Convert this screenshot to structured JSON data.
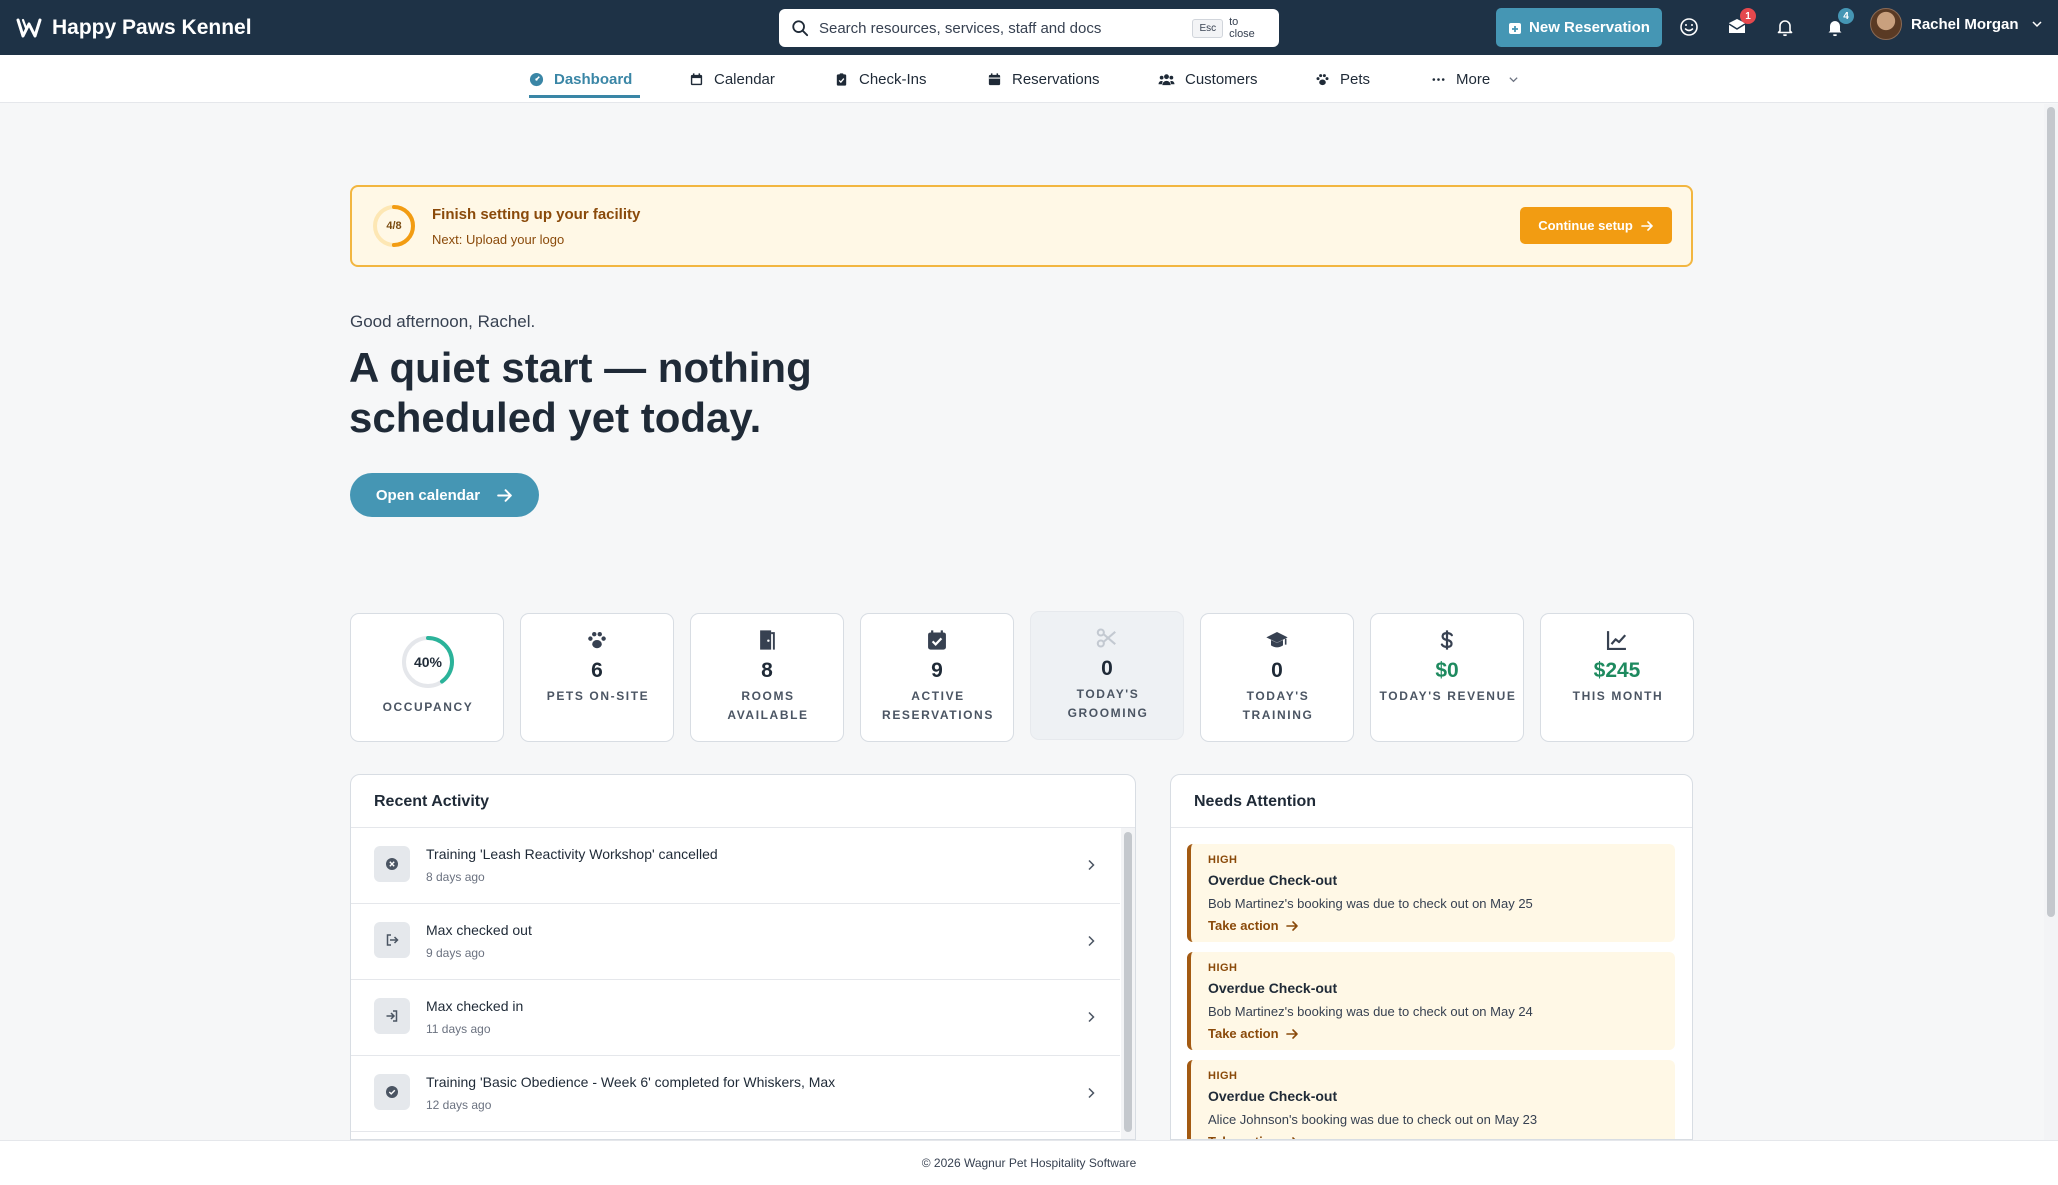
{
  "app": {
    "name": "Happy Paws Kennel"
  },
  "search": {
    "placeholder": "Search resources, services, staff and docs",
    "esc_key": "Esc",
    "esc_hint": "to close"
  },
  "header": {
    "new_reservation_label": "New Reservation",
    "messages_badge": "1",
    "notifications_badge": "4",
    "user_name": "Rachel Morgan",
    "colors": {
      "bar": "#1e3246",
      "accent": "#4596b4",
      "red_badge": "#e5484d",
      "blue_badge": "#4596b4"
    }
  },
  "nav": {
    "items": [
      {
        "label": "Dashboard",
        "icon": "dashboard-icon",
        "active": true
      },
      {
        "label": "Calendar",
        "icon": "calendar-icon"
      },
      {
        "label": "Check-Ins",
        "icon": "clipboard-icon"
      },
      {
        "label": "Reservations",
        "icon": "reservation-icon"
      },
      {
        "label": "Customers",
        "icon": "users-icon"
      },
      {
        "label": "Pets",
        "icon": "paw-icon"
      },
      {
        "label": "More",
        "icon": "ellipsis-icon"
      }
    ]
  },
  "setup": {
    "progress_label": "4/8",
    "progress_fraction": 0.5,
    "title": "Finish setting up your facility",
    "next": "Next: Upload your logo",
    "button_label": "Continue setup"
  },
  "hero": {
    "greeting": "Good afternoon, Rachel.",
    "headline": "A quiet start — nothing scheduled yet today.",
    "button_label": "Open calendar"
  },
  "stats": [
    {
      "key": "occupancy",
      "value": "40%",
      "fraction": 0.4,
      "label": "Occupancy"
    },
    {
      "key": "pets",
      "icon": "paw-icon",
      "value": "6",
      "label": "Pets On-Site"
    },
    {
      "key": "rooms",
      "icon": "door-icon",
      "value": "8",
      "label": "Rooms Available"
    },
    {
      "key": "reservations",
      "icon": "calendar-check-icon",
      "value": "9",
      "label": "Active Reservations"
    },
    {
      "key": "grooming",
      "icon": "scissors-icon",
      "value": "0",
      "label": "Today's Grooming"
    },
    {
      "key": "training",
      "icon": "graduation-cap-icon",
      "value": "0",
      "label": "Today's Training"
    },
    {
      "key": "revenue",
      "icon": "dollar-icon",
      "value": "$0",
      "label": "Today's Revenue"
    },
    {
      "key": "month",
      "icon": "chart-line-icon",
      "value": "$245",
      "label": "This Month"
    }
  ],
  "activity": {
    "title": "Recent Activity",
    "items": [
      {
        "icon": "cancel-icon",
        "title": "Training 'Leash Reactivity Workshop' cancelled",
        "time": "8 days ago"
      },
      {
        "icon": "checkout-icon",
        "title": "Max checked out",
        "time": "9 days ago"
      },
      {
        "icon": "checkin-icon",
        "title": "Max checked in",
        "time": "11 days ago"
      },
      {
        "icon": "check-circle-icon",
        "title": "Training 'Basic Obedience - Week 6' completed for Whiskers, Max",
        "time": "12 days ago"
      }
    ]
  },
  "attention": {
    "title": "Needs Attention",
    "action_label": "Take action",
    "items": [
      {
        "priority": "HIGH",
        "title": "Overdue Check-out",
        "desc": "Bob Martinez's booking was due to check out on May 25"
      },
      {
        "priority": "HIGH",
        "title": "Overdue Check-out",
        "desc": "Bob Martinez's booking was due to check out on May 24"
      },
      {
        "priority": "HIGH",
        "title": "Overdue Check-out",
        "desc": "Alice Johnson's booking was due to check out on May 23"
      }
    ]
  },
  "footer": {
    "text": "© 2026 Wagnur Pet Hospitality Software"
  }
}
